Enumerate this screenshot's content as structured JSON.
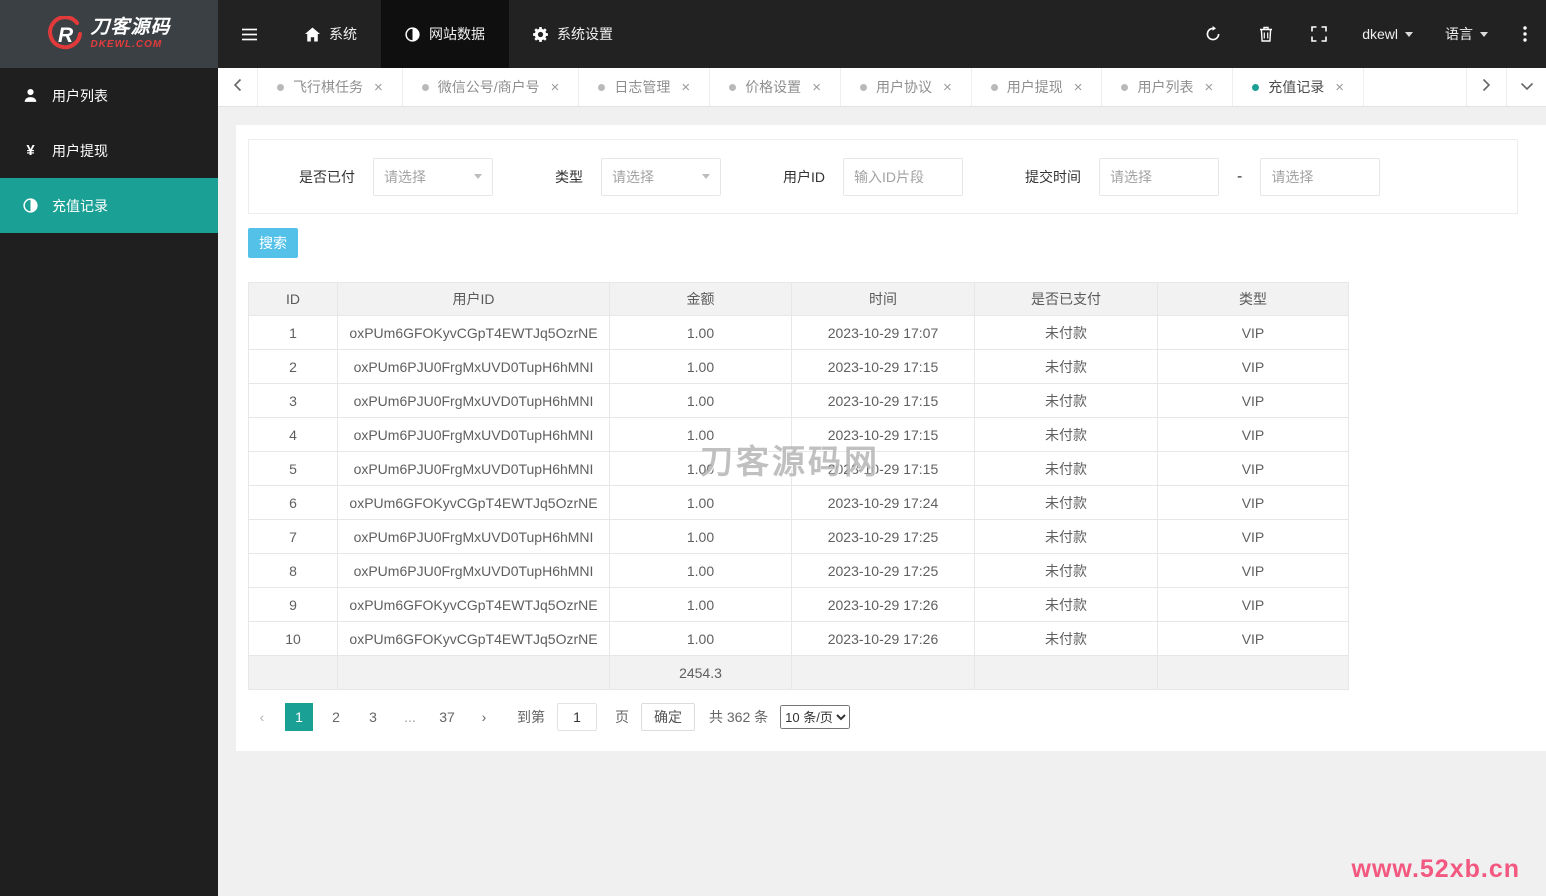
{
  "colors": {
    "accent": "#1aa094",
    "search_button": "#54c2e8",
    "corner_watermark": "#f25880"
  },
  "brand": {
    "logo_letter": "R",
    "title": "刀客源码",
    "subtitle": "DKEWL.COM"
  },
  "navbar": {
    "menu": [
      {
        "label": "系统",
        "active": false
      },
      {
        "label": "网站数据",
        "active": true
      },
      {
        "label": "系统设置",
        "active": false
      }
    ],
    "username": "dkewl",
    "language_label": "语言"
  },
  "tabs": [
    {
      "label": "飞行棋任务",
      "active": false
    },
    {
      "label": "微信公号/商户号",
      "active": false
    },
    {
      "label": "日志管理",
      "active": false
    },
    {
      "label": "价格设置",
      "active": false
    },
    {
      "label": "用户协议",
      "active": false
    },
    {
      "label": "用户提现",
      "active": false
    },
    {
      "label": "用户列表",
      "active": false
    },
    {
      "label": "充值记录",
      "active": true
    }
  ],
  "ui": {
    "tab_close_glyph": "×"
  },
  "sidebar": {
    "items": [
      {
        "label": "用户列表",
        "active": false
      },
      {
        "label": "用户提现",
        "active": false
      },
      {
        "label": "充值记录",
        "active": true
      }
    ]
  },
  "filters": {
    "paid": {
      "label": "是否已付",
      "placeholder": "请选择"
    },
    "type": {
      "label": "类型",
      "placeholder": "请选择"
    },
    "user_id": {
      "label": "用户ID",
      "placeholder": "输入ID片段"
    },
    "submit_time": {
      "label": "提交时间",
      "from_placeholder": "请选择",
      "to_placeholder": "请选择",
      "separator": "-"
    },
    "search_label": "搜索"
  },
  "table": {
    "headers": [
      "ID",
      "用户ID",
      "金额",
      "时间",
      "是否已支付",
      "类型"
    ],
    "rows": [
      [
        "1",
        "oxPUm6GFOKyvCGpT4EWTJq5OzrNE",
        "1.00",
        "2023-10-29 17:07",
        "未付款",
        "VIP"
      ],
      [
        "2",
        "oxPUm6PJU0FrgMxUVD0TupH6hMNI",
        "1.00",
        "2023-10-29 17:15",
        "未付款",
        "VIP"
      ],
      [
        "3",
        "oxPUm6PJU0FrgMxUVD0TupH6hMNI",
        "1.00",
        "2023-10-29 17:15",
        "未付款",
        "VIP"
      ],
      [
        "4",
        "oxPUm6PJU0FrgMxUVD0TupH6hMNI",
        "1.00",
        "2023-10-29 17:15",
        "未付款",
        "VIP"
      ],
      [
        "5",
        "oxPUm6PJU0FrgMxUVD0TupH6hMNI",
        "1.00",
        "2023-10-29 17:15",
        "未付款",
        "VIP"
      ],
      [
        "6",
        "oxPUm6GFOKyvCGpT4EWTJq5OzrNE",
        "1.00",
        "2023-10-29 17:24",
        "未付款",
        "VIP"
      ],
      [
        "7",
        "oxPUm6PJU0FrgMxUVD0TupH6hMNI",
        "1.00",
        "2023-10-29 17:25",
        "未付款",
        "VIP"
      ],
      [
        "8",
        "oxPUm6PJU0FrgMxUVD0TupH6hMNI",
        "1.00",
        "2023-10-29 17:25",
        "未付款",
        "VIP"
      ],
      [
        "9",
        "oxPUm6GFOKyvCGpT4EWTJq5OzrNE",
        "1.00",
        "2023-10-29 17:26",
        "未付款",
        "VIP"
      ],
      [
        "10",
        "oxPUm6GFOKyvCGpT4EWTJq5OzrNE",
        "1.00",
        "2023-10-29 17:26",
        "未付款",
        "VIP"
      ]
    ],
    "total_amount": "2454.3",
    "total_column_index": 2
  },
  "pagination": {
    "prev": "‹",
    "next": "›",
    "pages": [
      "1",
      "2",
      "3",
      "...",
      "37"
    ],
    "current": "1",
    "goto_prefix": "到第",
    "goto_value": "1",
    "goto_suffix": "页",
    "confirm_label": "确定",
    "total_text": "共 362 条",
    "page_size_option": "10 条/页"
  },
  "watermarks": {
    "table_watermark": "刀客源码网",
    "corner_watermark": "www.52xb.cn"
  }
}
